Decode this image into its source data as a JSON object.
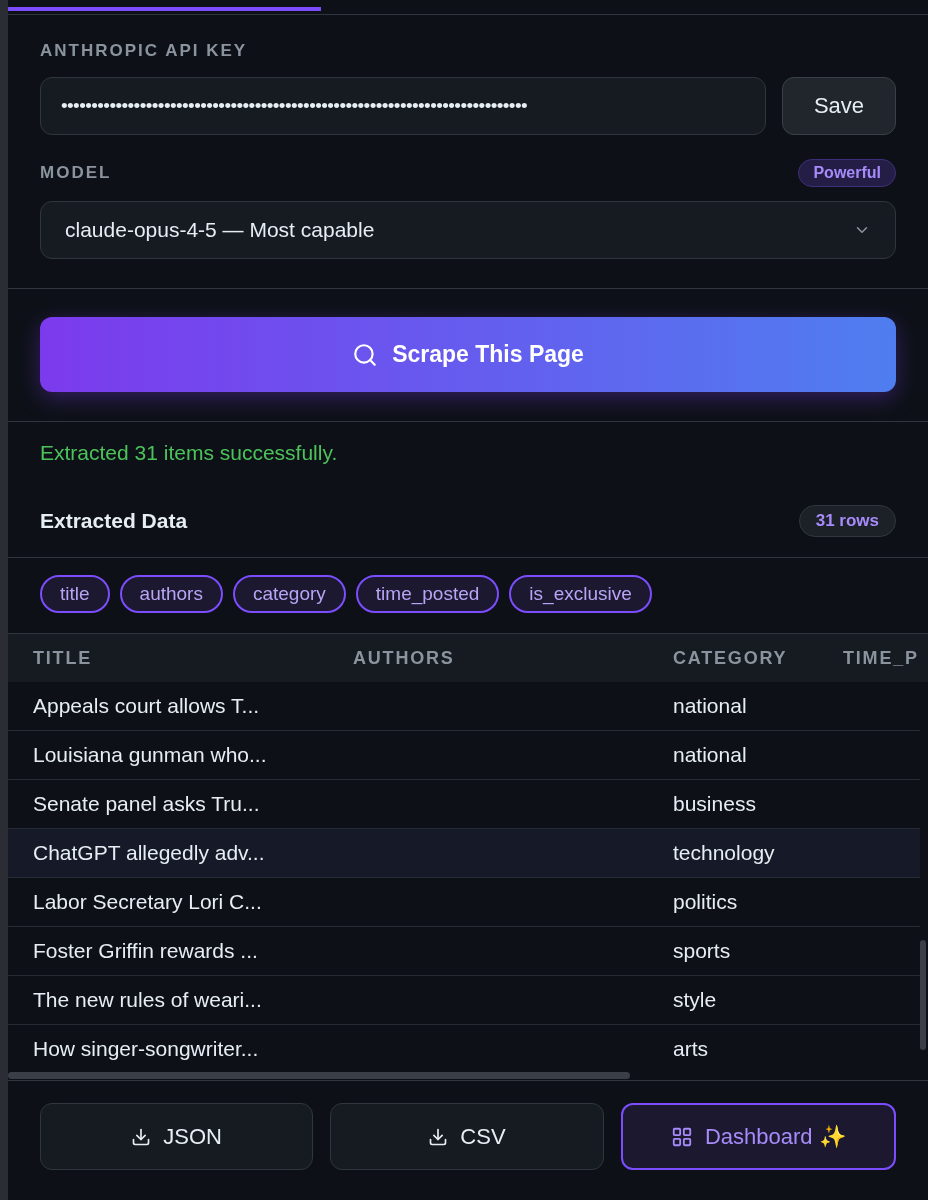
{
  "progress": {
    "level": 0.34
  },
  "api_key": {
    "label": "ANTHROPIC API KEY",
    "value": "•••••••••••••••••••••••••••••••••••••••••••••••••••••••••••••••••••••••••••••",
    "save_button": "Save"
  },
  "model": {
    "label": "MODEL",
    "badge": "Powerful",
    "value": "claude-opus-4-5 — Most capable"
  },
  "scrape_button": "Scrape This Page",
  "status": "Extracted 31 items successfully.",
  "extracted": {
    "title": "Extracted Data",
    "count": "31 rows"
  },
  "fields": [
    "title",
    "authors",
    "category",
    "time_posted",
    "is_exclusive"
  ],
  "table": {
    "columns": [
      "TITLE",
      "AUTHORS",
      "CATEGORY",
      "TIME_P"
    ],
    "rows": [
      {
        "title": "Appeals court allows T...",
        "category": "national",
        "selected": false
      },
      {
        "title": "Louisiana gunman who...",
        "category": "national",
        "selected": false
      },
      {
        "title": "Senate panel asks Tru...",
        "category": "business",
        "selected": false
      },
      {
        "title": "ChatGPT allegedly adv...",
        "category": "technology",
        "selected": true
      },
      {
        "title": "Labor Secretary Lori C...",
        "category": "politics",
        "selected": false
      },
      {
        "title": "Foster Griffin rewards ...",
        "category": "sports",
        "selected": false
      },
      {
        "title": "The new rules of weari...",
        "category": "style",
        "selected": false
      },
      {
        "title": "How singer-songwriter...",
        "category": "arts",
        "selected": false
      }
    ]
  },
  "actions": [
    {
      "kind": "download",
      "label": "JSON"
    },
    {
      "kind": "download",
      "label": "CSV"
    },
    {
      "kind": "dashboard",
      "label": "Dashboard ✨"
    }
  ]
}
